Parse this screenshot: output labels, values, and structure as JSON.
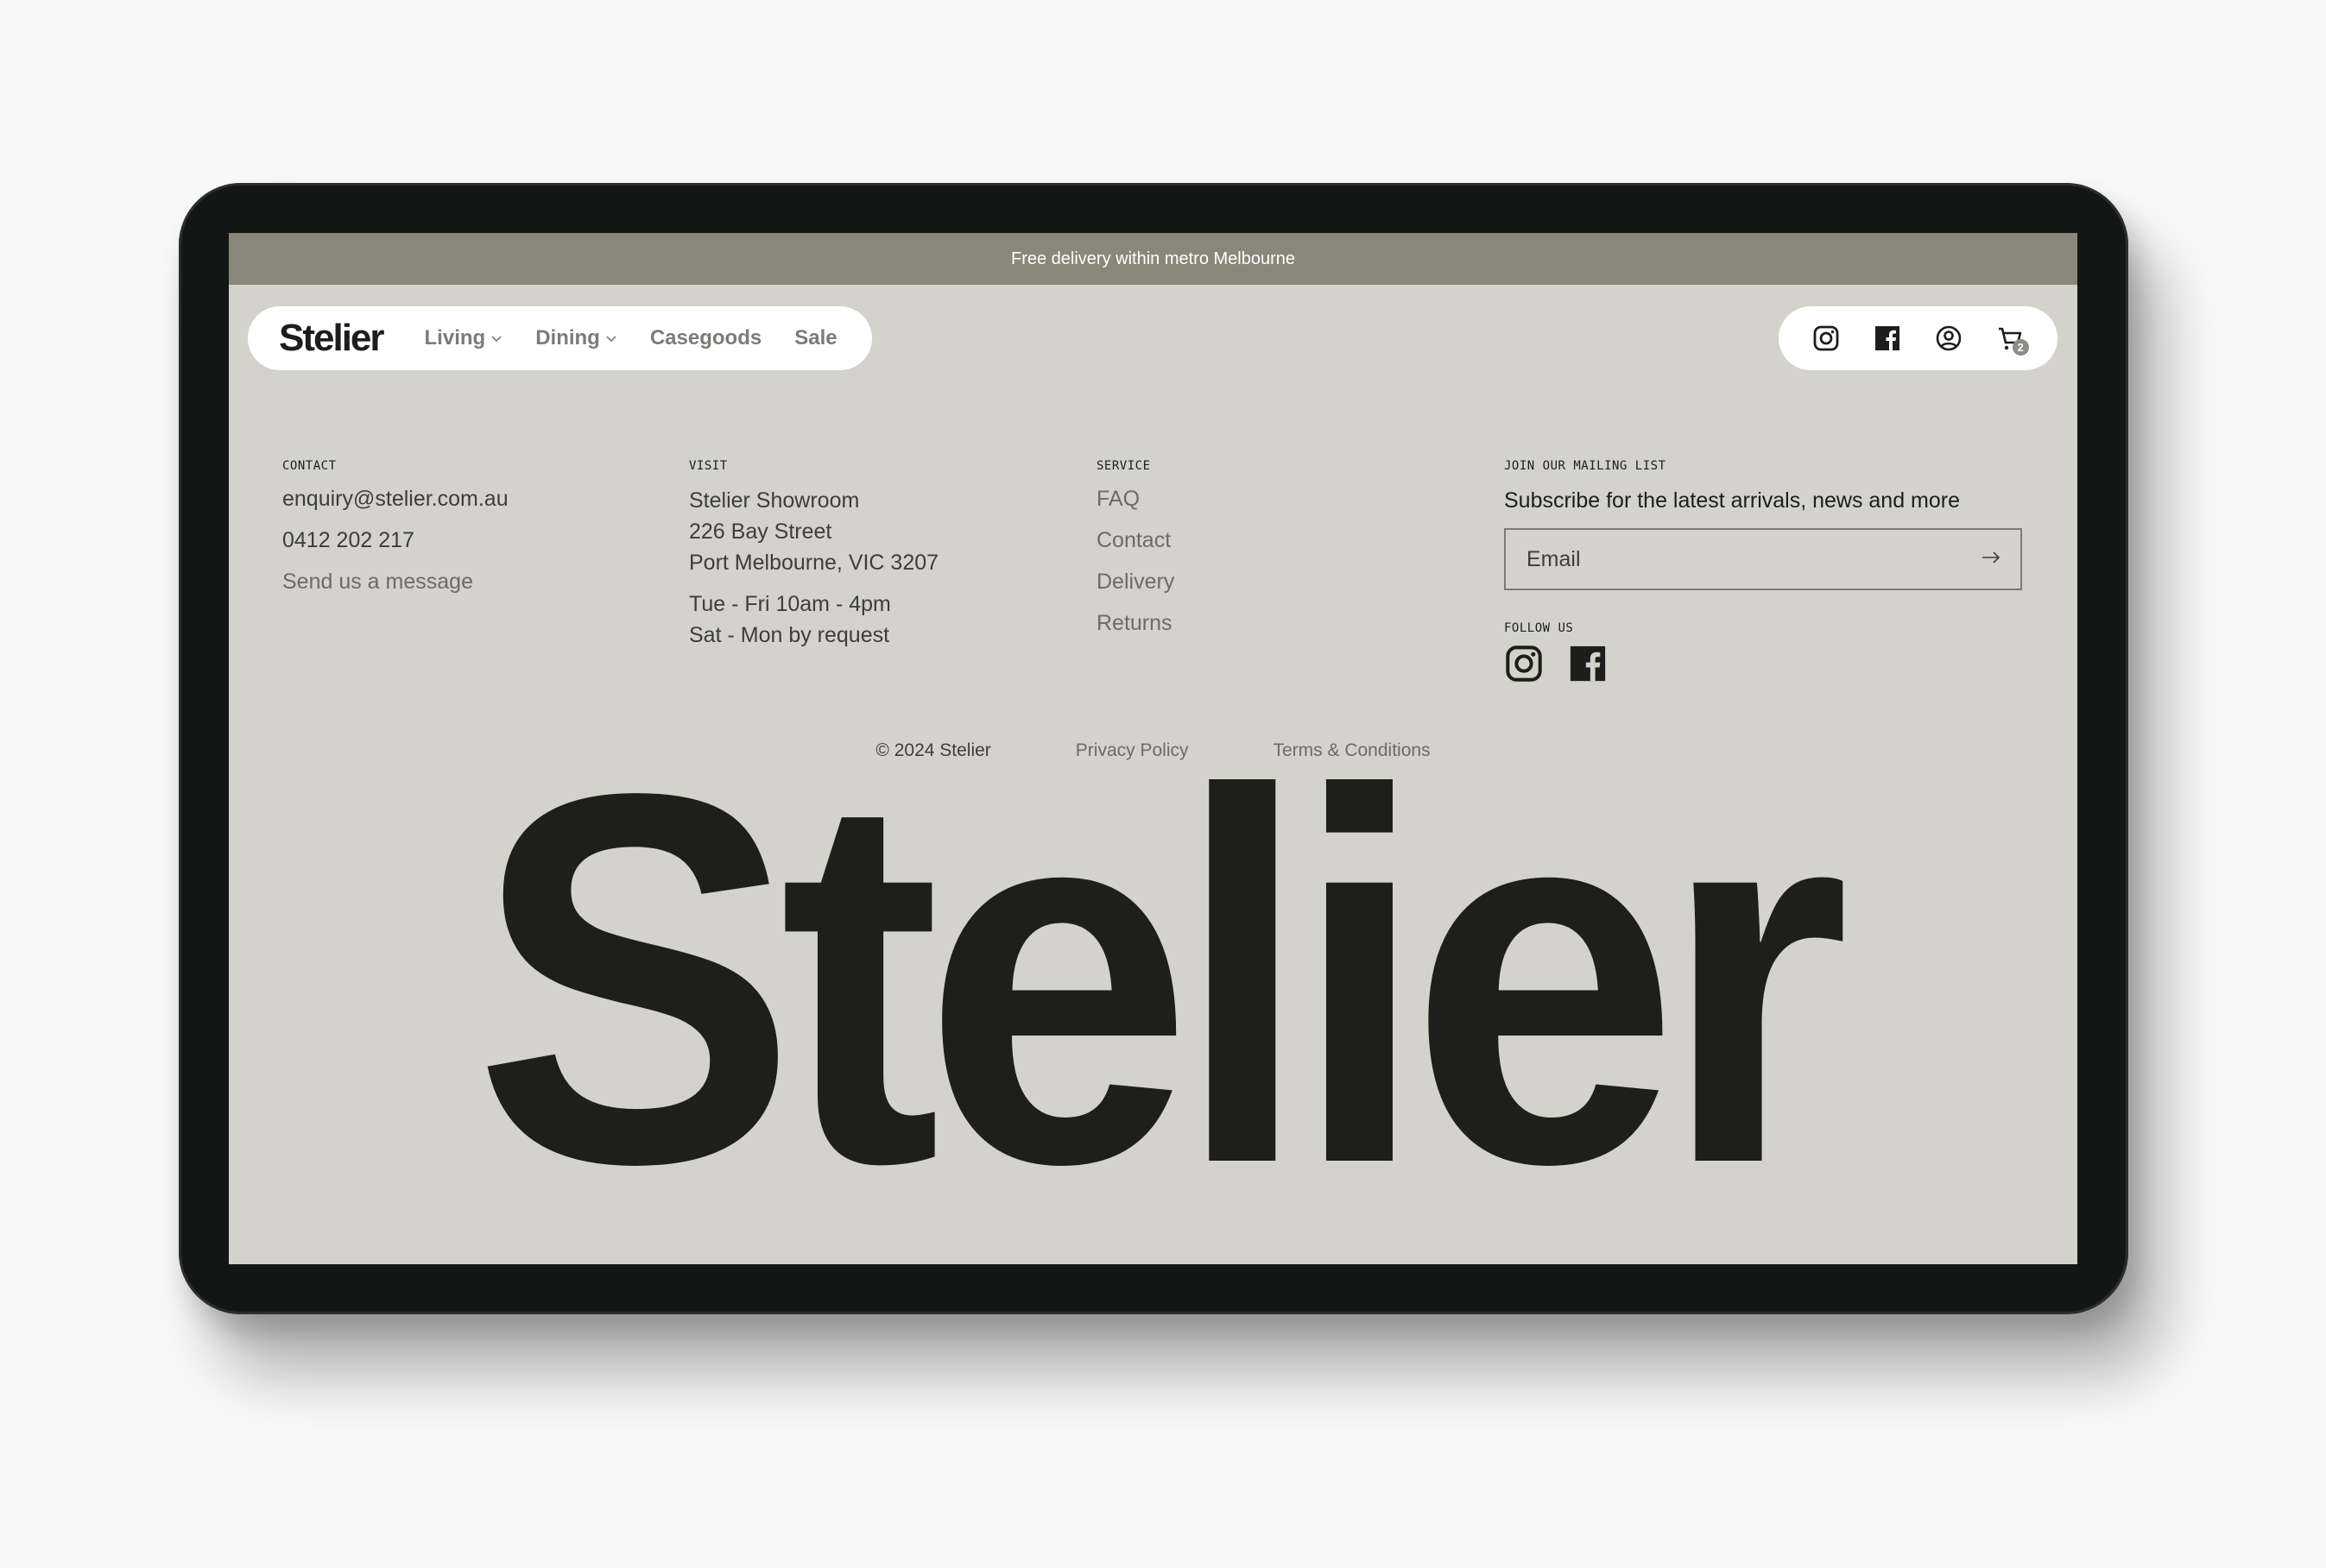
{
  "banner": {
    "text": "Free delivery within metro Melbourne"
  },
  "header": {
    "logo": "Stelier",
    "nav": [
      {
        "label": "Living",
        "has_dropdown": true
      },
      {
        "label": "Dining",
        "has_dropdown": true
      },
      {
        "label": "Casegoods",
        "has_dropdown": false
      },
      {
        "label": "Sale",
        "has_dropdown": false
      }
    ],
    "icons": [
      "instagram-icon",
      "facebook-icon",
      "account-icon",
      "cart-icon"
    ],
    "cart_count": "2"
  },
  "footer": {
    "contact": {
      "heading": "CONTACT",
      "email": "enquiry@stelier.com.au",
      "phone": "0412 202 217",
      "message_link": "Send us a message"
    },
    "visit": {
      "heading": "VISIT",
      "address": [
        "Stelier Showroom",
        "226 Bay Street",
        "Port Melbourne, VIC 3207"
      ],
      "hours": [
        "Tue - Fri 10am - 4pm",
        "Sat - Mon by request"
      ]
    },
    "service": {
      "heading": "SERVICE",
      "links": [
        "FAQ",
        "Contact",
        "Delivery",
        "Returns"
      ]
    },
    "mailing": {
      "heading": "JOIN OUR MAILING LIST",
      "text": "Subscribe for the latest arrivals, news and more",
      "email_placeholder": "Email",
      "email_value": "",
      "follow_heading": "FOLLOW US"
    },
    "bottom": {
      "copyright": "© 2024 Stelier",
      "privacy": "Privacy Policy",
      "terms": "Terms & Conditions"
    },
    "wordmark": "Stelier"
  },
  "colors": {
    "banner_bg": "#898779",
    "page_bg": "#d3d3cb",
    "text_dark": "#1d1d1b",
    "text_muted": "#6c6b64",
    "device_frame": "#141615"
  }
}
